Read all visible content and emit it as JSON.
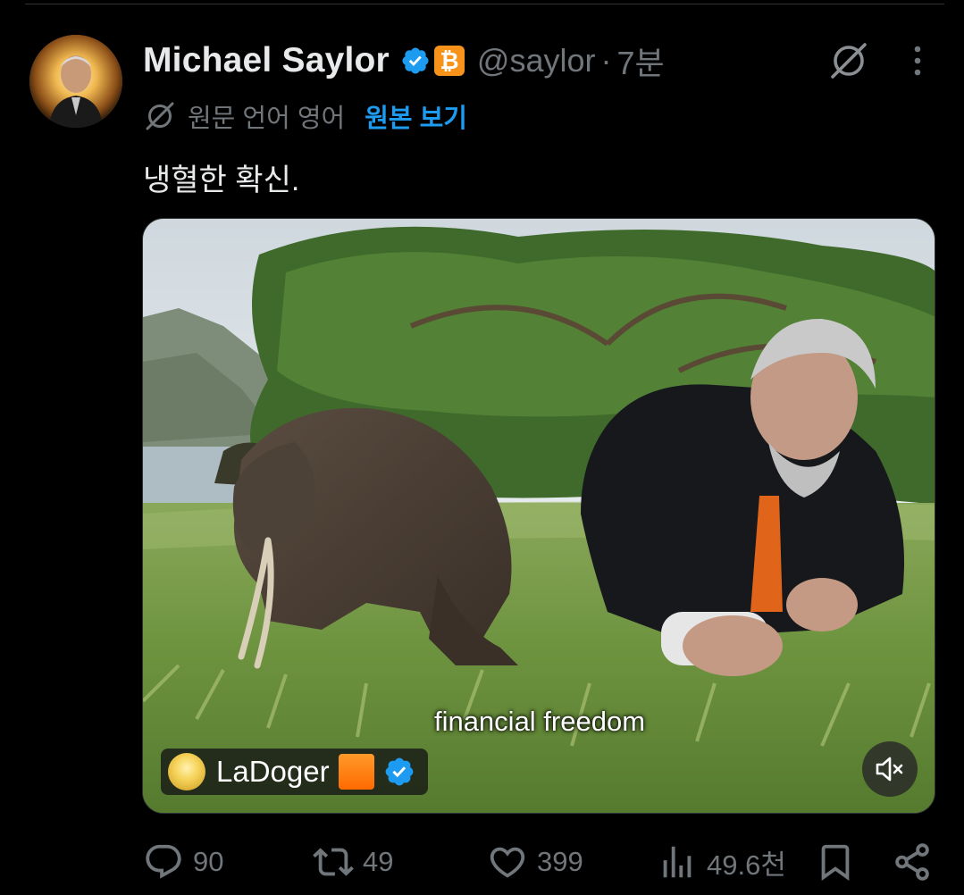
{
  "tweet": {
    "author": {
      "display_name": "Michael Saylor",
      "handle": "@saylor",
      "verified_icon": "verified-badge-icon",
      "affiliate_badge": "₿"
    },
    "separator": "·",
    "time_ago": "7분",
    "translation": {
      "language_note": "원문 언어 영어",
      "show_original_label": "원본 보기"
    },
    "text": "냉혈한 확신.",
    "media": {
      "caption": "financial freedom",
      "watermark_name": "LaDoger",
      "mute_icon": "muted-speaker-icon"
    },
    "actions": {
      "replies": "90",
      "reposts": "49",
      "likes": "399",
      "views": "49.6천"
    }
  },
  "colors": {
    "background": "#000000",
    "text_primary": "#e7e9ea",
    "text_secondary": "#71767b",
    "accent": "#1d9bf0",
    "bitcoin": "#f7931a"
  }
}
